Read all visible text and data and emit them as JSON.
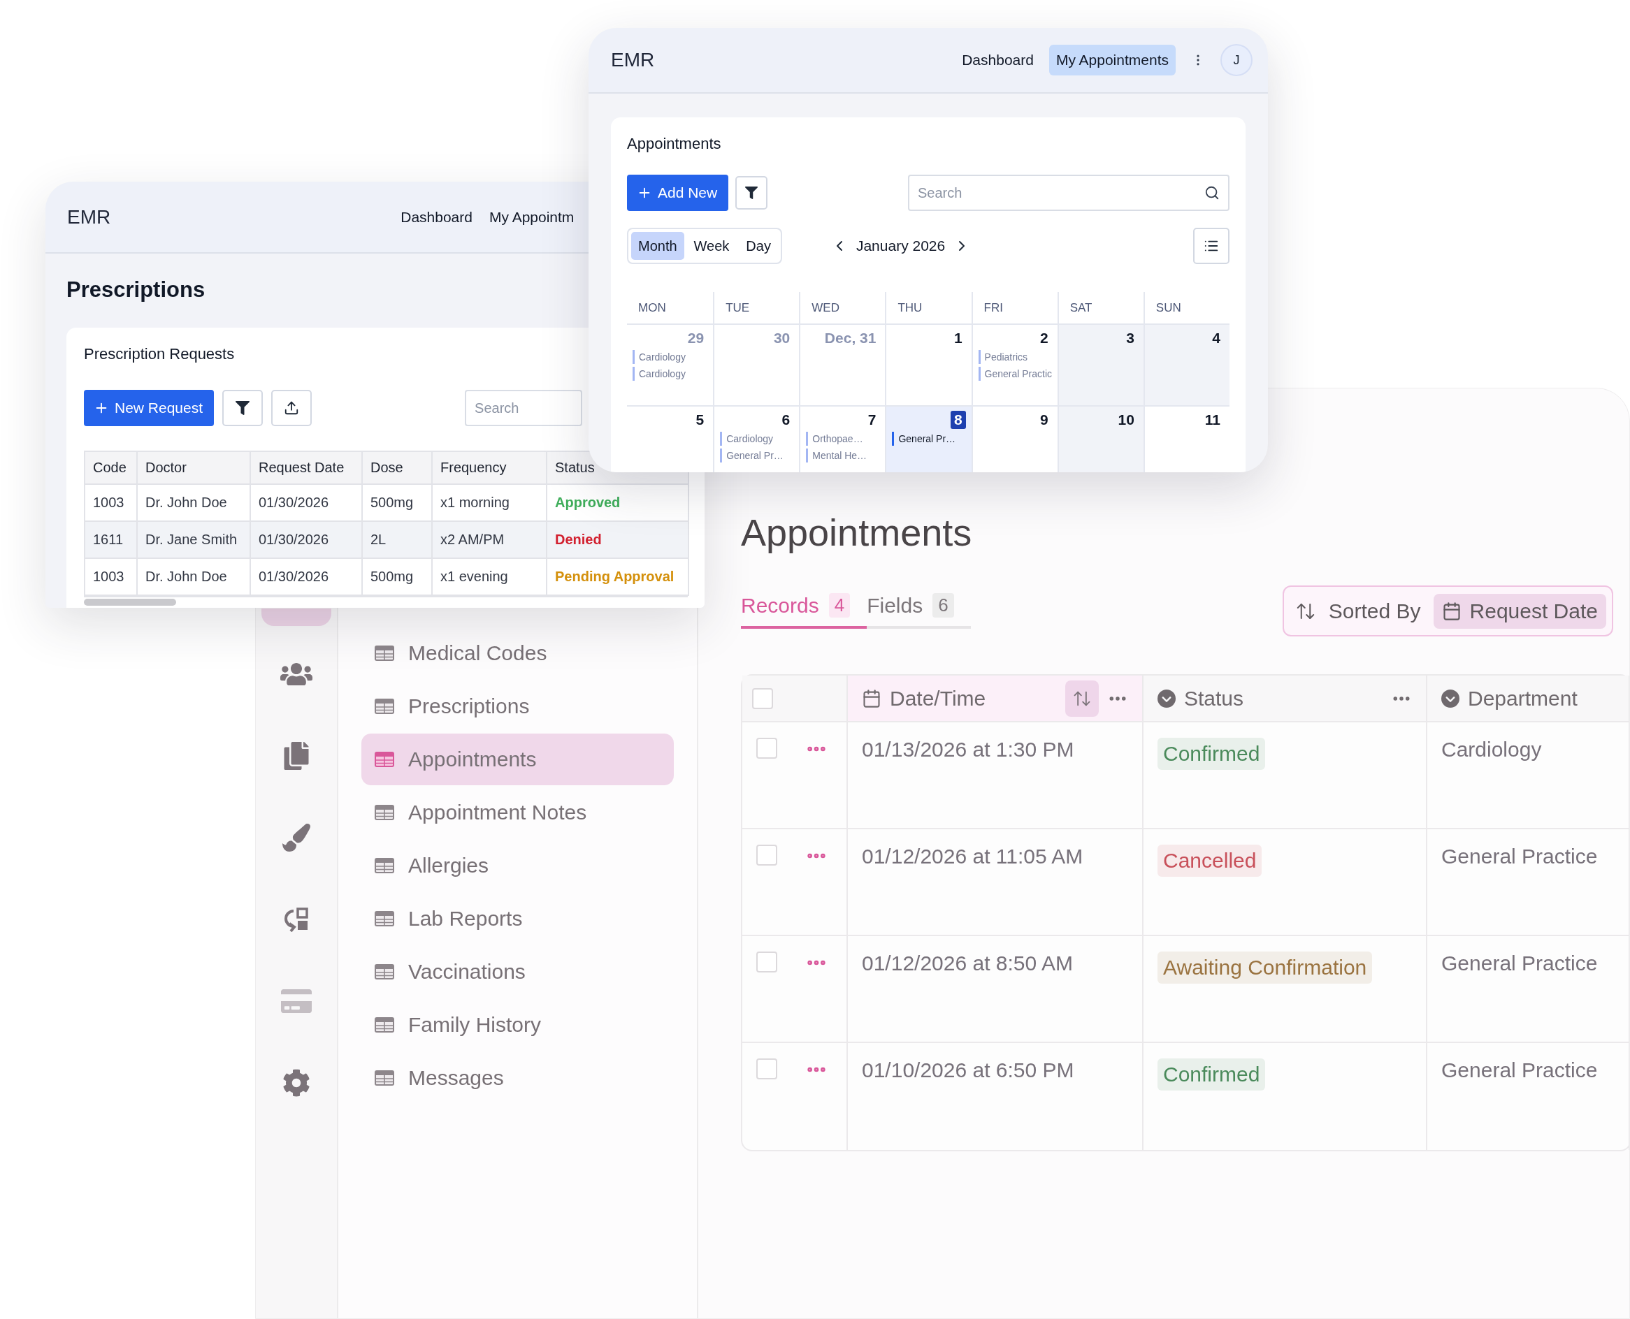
{
  "background_app": {
    "rail": [
      {
        "selected": true
      },
      {
        "selected": false
      },
      {
        "selected": false
      },
      {
        "selected": false
      },
      {
        "selected": false
      },
      {
        "selected": false
      },
      {
        "selected": false
      }
    ],
    "nav": [
      {
        "label": "Medical Codes",
        "selected": false
      },
      {
        "label": "Prescriptions",
        "selected": false
      },
      {
        "label": "Appointments",
        "selected": true
      },
      {
        "label": "Appointment Notes",
        "selected": false
      },
      {
        "label": "Allergies",
        "selected": false
      },
      {
        "label": "Lab Reports",
        "selected": false
      },
      {
        "label": "Vaccinations",
        "selected": false
      },
      {
        "label": "Family History",
        "selected": false
      },
      {
        "label": "Messages",
        "selected": false
      }
    ],
    "title": "Appointments",
    "tabs": [
      {
        "label": "Records",
        "count": "4",
        "selected": true
      },
      {
        "label": "Fields",
        "count": "6",
        "selected": false
      }
    ],
    "sort": {
      "label": "Sorted By",
      "field": "Request Date"
    },
    "table": {
      "all_checked": false,
      "columns": [
        {
          "label": "Date/Time",
          "kind": "date",
          "sorted": true,
          "menu": true
        },
        {
          "label": "Status",
          "kind": "select",
          "sorted": false,
          "menu": true
        },
        {
          "label": "Department",
          "kind": "select",
          "sorted": false,
          "menu": false
        }
      ],
      "rows": [
        {
          "checked": false,
          "date_time": "01/13/2026 at 1:30 PM",
          "status": "Confirmed",
          "color": "#4a8a5b",
          "department": "Cardiology"
        },
        {
          "checked": false,
          "date_time": "01/12/2026 at 11:05 AM",
          "status": "Cancelled",
          "color": "#c8505a",
          "department": "General Practice"
        },
        {
          "checked": false,
          "date_time": "01/12/2026 at 8:50 AM",
          "status": "Awaiting Confirmation",
          "color": "#9a7340",
          "department": "General Practice"
        },
        {
          "checked": false,
          "date_time": "01/10/2026 at 6:50 PM",
          "status": "Confirmed",
          "color": "#4a8a5b",
          "department": "General Practice"
        }
      ]
    }
  },
  "prescriptions_window": {
    "brand": "EMR",
    "nav": [
      {
        "label": "Dashboard",
        "selected": false
      },
      {
        "label": "My Appointm",
        "selected": false
      }
    ],
    "title": "Prescriptions",
    "card_title": "Prescription Requests",
    "new_button": "New Request",
    "search": {
      "placeholder": "Search"
    },
    "table": {
      "columns": [
        "Code",
        "Doctor",
        "Request Date",
        "Dose",
        "Frequency",
        "Status"
      ],
      "rows": [
        {
          "cells": [
            "1003",
            "Dr. John Doe",
            "01/30/2026",
            "500mg",
            "x1 morning"
          ],
          "status": "Approved",
          "color": "#3fae5b"
        },
        {
          "cells": [
            "1611",
            "Dr. Jane Smith",
            "01/30/2026",
            "2L",
            "x2 AM/PM"
          ],
          "status": "Denied",
          "color": "#d2202f"
        },
        {
          "cells": [
            "1003",
            "Dr. John Doe",
            "01/30/2026",
            "500mg",
            "x1 evening"
          ],
          "status": "Pending Approval",
          "color": "#d4900c"
        }
      ]
    }
  },
  "calendar_window": {
    "brand": "EMR",
    "nav": [
      {
        "label": "Dashboard",
        "selected": false
      },
      {
        "label": "My Appointments",
        "selected": true
      }
    ],
    "avatar": "J",
    "card_title": "Appointments",
    "add_button": "Add New",
    "search": {
      "placeholder": "Search"
    },
    "views": [
      {
        "label": "Month",
        "selected": true
      },
      {
        "label": "Week",
        "selected": false
      },
      {
        "label": "Day",
        "selected": false
      }
    ],
    "month": "January 2026",
    "weekdays": [
      "MON",
      "TUE",
      "WED",
      "THU",
      "FRI",
      "SAT",
      "SUN"
    ],
    "weeks": [
      [
        {
          "day": "29",
          "muted": true,
          "shaded": false,
          "today": false,
          "events": [
            "Cardiology",
            "Cardiology"
          ]
        },
        {
          "day": "30",
          "muted": true,
          "shaded": false,
          "today": false
        },
        {
          "day": "Dec, 31",
          "muted": true,
          "shaded": false,
          "today": false
        },
        {
          "day": "1",
          "muted": false,
          "shaded": false,
          "today": false
        },
        {
          "day": "2",
          "muted": false,
          "shaded": false,
          "today": false,
          "events": [
            "Pediatrics",
            "General Practic"
          ]
        },
        {
          "day": "3",
          "muted": false,
          "shaded": true,
          "today": false
        },
        {
          "day": "4",
          "muted": false,
          "shaded": true,
          "today": false
        }
      ],
      [
        {
          "day": "5",
          "muted": false,
          "shaded": false,
          "today": false
        },
        {
          "day": "6",
          "muted": false,
          "shaded": false,
          "today": false,
          "events": [
            "Cardiology",
            "General Pr…"
          ]
        },
        {
          "day": "7",
          "muted": false,
          "shaded": false,
          "today": false,
          "events": [
            "Orthopae…",
            "Mental He…"
          ]
        },
        {
          "day": "8",
          "muted": false,
          "shaded": false,
          "today": true,
          "events": [
            "General Pr…"
          ]
        },
        {
          "day": "9",
          "muted": false,
          "shaded": false,
          "today": false
        },
        {
          "day": "10",
          "muted": false,
          "shaded": true,
          "today": false
        },
        {
          "day": "11",
          "muted": false,
          "shaded": false,
          "today": false
        }
      ]
    ]
  }
}
